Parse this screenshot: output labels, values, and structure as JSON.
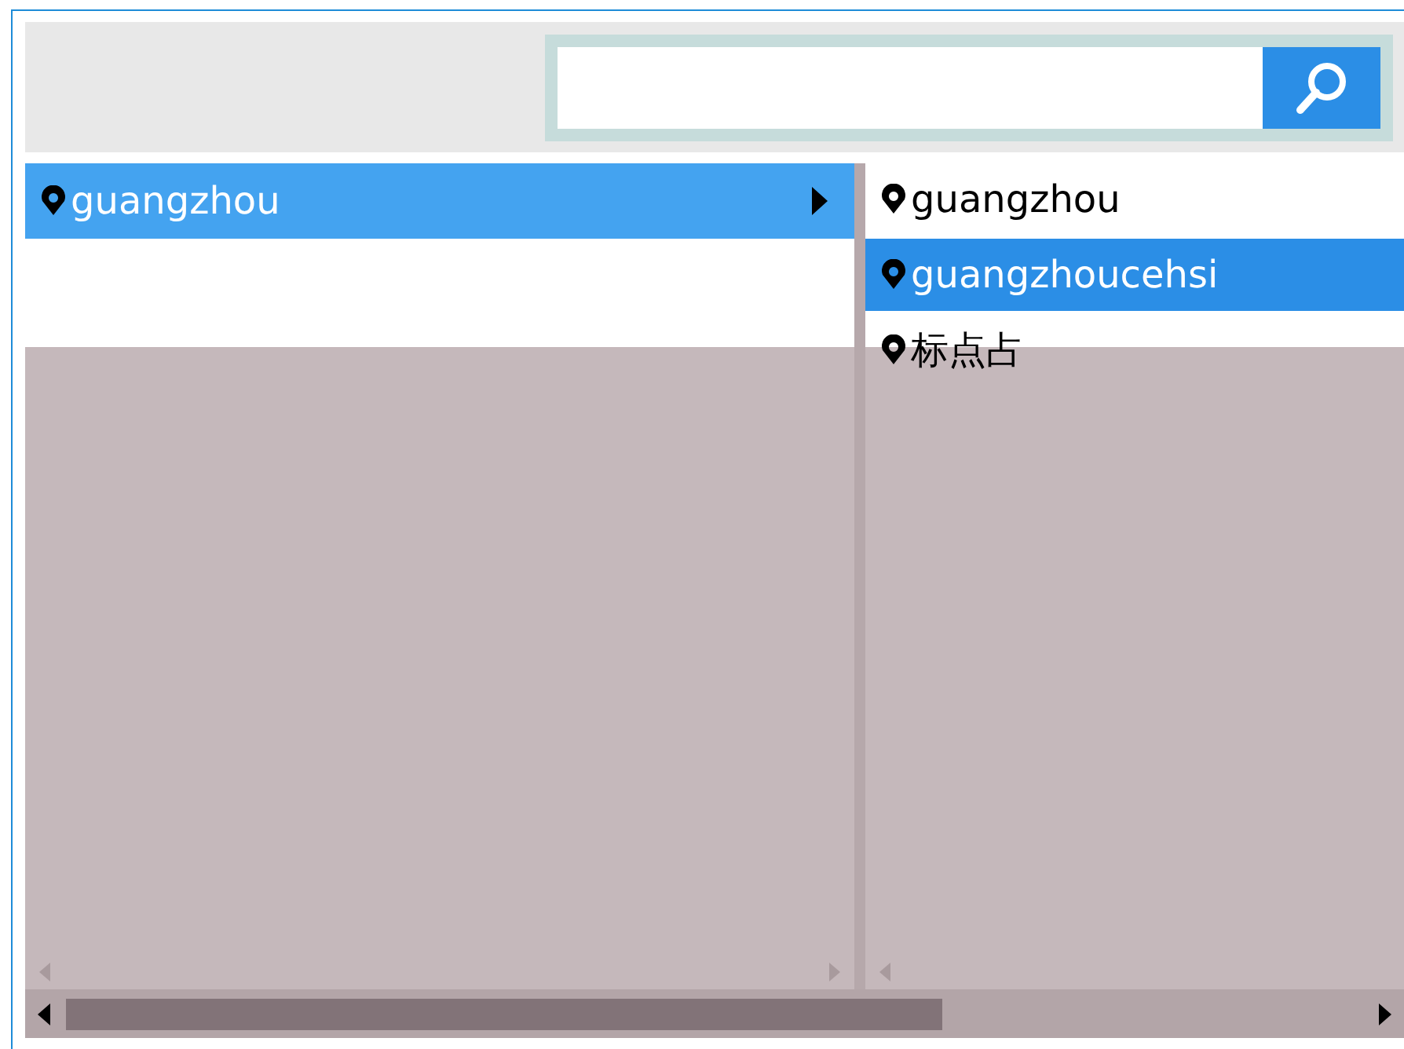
{
  "left_list": {
    "items": [
      {
        "label": "guangzhou",
        "selected": true,
        "expandable": true
      }
    ]
  },
  "right_list": {
    "items": [
      {
        "label": "guangzhou",
        "selected": false
      },
      {
        "label": "guangzhoucehsi",
        "selected": true
      },
      {
        "label": "标点占",
        "selected": false
      }
    ]
  }
}
